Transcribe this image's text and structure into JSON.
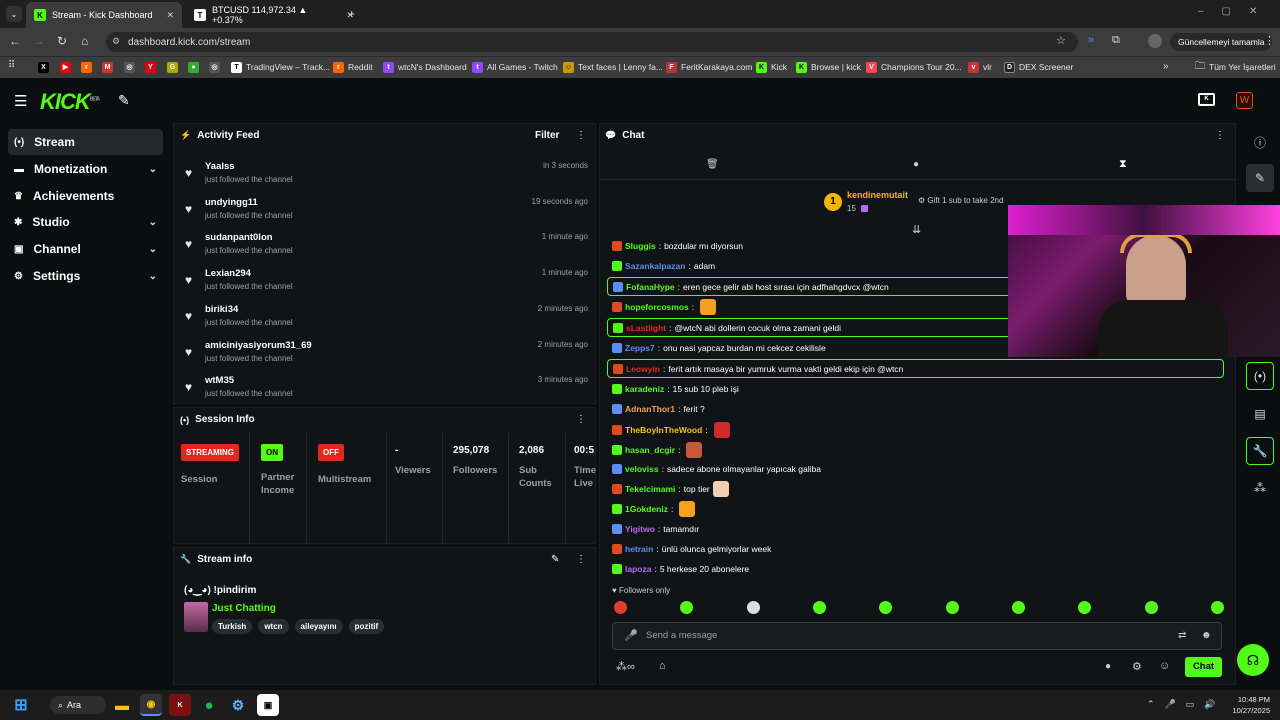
{
  "browser": {
    "tabs": [
      {
        "label": "Stream - Kick Dashboard",
        "icon": "kick-icon"
      },
      {
        "label": "BTCUSD 114,972.34 ▲ +0.37%",
        "icon": "tradingview-icon"
      }
    ],
    "url": "dashboard.kick.com/stream",
    "update_label": "Güncellemeyi tamamla",
    "bookmarks": [
      "TradingView – Track...",
      "Reddit",
      "wtcN's Dashboard",
      "All Games - Twitch",
      "Text faces | Lenny fa...",
      "FeritKarakaya.com",
      "Kick",
      "Browse | kick",
      "Champions Tour 20...",
      "vlr",
      "DEX Screener"
    ],
    "all_bookmarks": "Tüm Yer İşaretleri"
  },
  "brand": {
    "logo": "KICK",
    "beta": "BETA",
    "accent": "#53fc18"
  },
  "sidebar": [
    {
      "label": "Stream",
      "icon": "broadcast-icon",
      "selected": true
    },
    {
      "label": "Monetization",
      "icon": "monetization-icon",
      "chevron": true
    },
    {
      "label": "Achievements",
      "icon": "achievements-icon"
    },
    {
      "label": "Studio",
      "icon": "studio-icon",
      "chevron": true
    },
    {
      "label": "Channel",
      "icon": "channel-icon",
      "chevron": true
    },
    {
      "label": "Settings",
      "icon": "gear-icon",
      "chevron": true
    }
  ],
  "activity": {
    "title": "Activity Feed",
    "filter": "Filter",
    "items": [
      {
        "name": "Yaalss",
        "action": "just followed the channel",
        "time": "in 3 seconds"
      },
      {
        "name": "undyingg11",
        "action": "just followed the channel",
        "time": "19 seconds ago"
      },
      {
        "name": "sudanpant0lon",
        "action": "just followed the channel",
        "time": "1 minute ago"
      },
      {
        "name": "Lexian294",
        "action": "just followed the channel",
        "time": "1 minute ago"
      },
      {
        "name": "biriki34",
        "action": "just followed the channel",
        "time": "2 minutes ago"
      },
      {
        "name": "amiciniyasiyorum31_69",
        "action": "just followed the channel",
        "time": "2 minutes ago"
      },
      {
        "name": "wtM35",
        "action": "just followed the channel",
        "time": "3 minutes ago"
      }
    ]
  },
  "session": {
    "title": "Session Info",
    "cols": [
      {
        "pill": "STREAMING",
        "label": "Session"
      },
      {
        "pill": "ON",
        "label": "Partner Income"
      },
      {
        "pill": "OFF",
        "label": "Multistream"
      },
      {
        "value": "-",
        "label": "Viewers"
      },
      {
        "value": "295,078",
        "label": "Followers"
      },
      {
        "value": "2,086",
        "label": "Sub Counts"
      },
      {
        "value": "00:5",
        "label": "Time Live"
      }
    ]
  },
  "stream_info": {
    "title": "Stream info",
    "stream_title": "(◕‿◕) !pindirim",
    "category": "Just Chatting",
    "tags": [
      "Turkish",
      "wtcn",
      "aileyayını",
      "pozitif"
    ]
  },
  "chat": {
    "title": "Chat",
    "leader": {
      "rank": "1",
      "name": "kendinemutait",
      "count": "15",
      "gift": "Gift 1 sub to take 2nd"
    },
    "messages": [
      {
        "user": "Sluggis",
        "color": "#53fc18",
        "text": "bozdular mı diyorsun"
      },
      {
        "user": "Sazankalpazan",
        "color": "#5b8df5",
        "text": "adam"
      },
      {
        "user": "FofanaHype",
        "color": "#53fc18",
        "text": "eren gece gelir abi host sırası için adfhahgdvcx @wtcn",
        "hl": true
      },
      {
        "user": "hopeforcosmos",
        "color": "#53fc18",
        "text": "",
        "emote": true
      },
      {
        "user": "sLastlight",
        "color": "#e0281f",
        "text": "@wtcN abi dollerin cocuk olma zamani geldi",
        "hl": true
      },
      {
        "user": "Zepps7",
        "color": "#5b8df5",
        "text": "onu nasi yapcaz burdan mi cekcez cekilisle"
      },
      {
        "user": "Leowyin",
        "color": "#e0281f",
        "text": "ferit artık masaya bir yumruk vurma vakti geldi ekip için @wtcn",
        "hl": true
      },
      {
        "user": "karadeniz",
        "color": "#53fc18",
        "text": "15 sub 10 pleb işi"
      },
      {
        "user": "AdnanThor1",
        "color": "#f5a35b",
        "text": "ferit ?"
      },
      {
        "user": "TheBoyInTheWood",
        "color": "#f5c518",
        "text": "",
        "emote": true
      },
      {
        "user": "hasan_dcgir",
        "color": "#53fc18",
        "text": "",
        "emote": true
      },
      {
        "user": "veloviss",
        "color": "#53fc18",
        "text": "sadece abone olmayanlar yapıcak galiba"
      },
      {
        "user": "Tekelcimami",
        "color": "#53fc18",
        "text": "top tier",
        "emote": true
      },
      {
        "user": "1Gokdeniz",
        "color": "#53fc18",
        "text": "",
        "emote": true
      },
      {
        "user": "Yigitwo",
        "color": "#b36bf5",
        "text": "tamamdır"
      },
      {
        "user": "hetrain",
        "color": "#5b8df5",
        "text": "ünlü olunca gelmiyorlar week"
      },
      {
        "user": "lapoza",
        "color": "#b36bf5",
        "text": "5 herkese 20 abonelere"
      }
    ],
    "followers_only": "Followers only",
    "placeholder": "Send a message",
    "send": "Chat"
  },
  "taskbar": {
    "search": "Ara",
    "time": "10:48 PM",
    "date": "10/27/2025"
  }
}
